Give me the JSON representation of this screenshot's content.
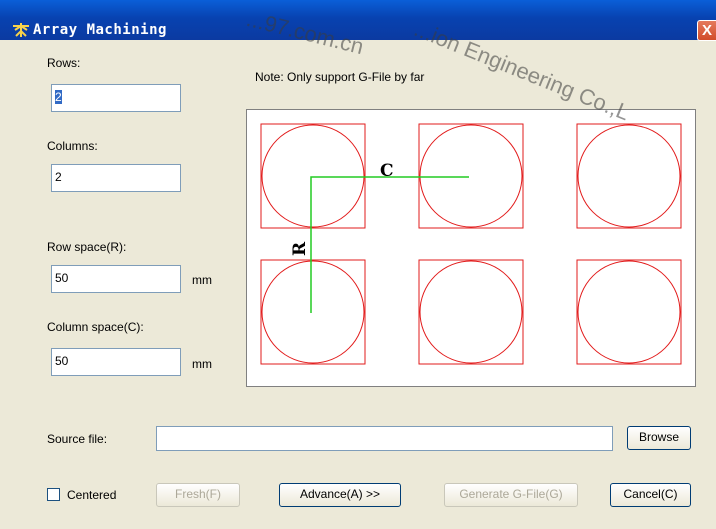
{
  "window": {
    "title": "Array Machining",
    "close_glyph": "X"
  },
  "note": "Note: Only support G-File by far",
  "rows": {
    "label": "Rows:",
    "value": "2"
  },
  "columns": {
    "label": "Columns:",
    "value": "2"
  },
  "row_space": {
    "label": "Row space(R):",
    "value": "50",
    "unit": "mm"
  },
  "column_space": {
    "label": "Column space(C):",
    "value": "50",
    "unit": "mm"
  },
  "source_file": {
    "label": "Source file:",
    "value": ""
  },
  "buttons": {
    "browse": "Browse",
    "fresh": "Fresh(F)",
    "advance": "Advance(A) >>",
    "generate": "Generate G-File(G)",
    "cancel": "Cancel(C)"
  },
  "centered": {
    "label": "Centered",
    "checked": false
  },
  "preview": {
    "row_marker": "R",
    "column_marker": "C",
    "grid_color": "#e21b1b",
    "guide_color": "#22cc22"
  },
  "watermark": {
    "line1": "...97.com.cn",
    "line2": "...ion Engineering Co.,L"
  }
}
